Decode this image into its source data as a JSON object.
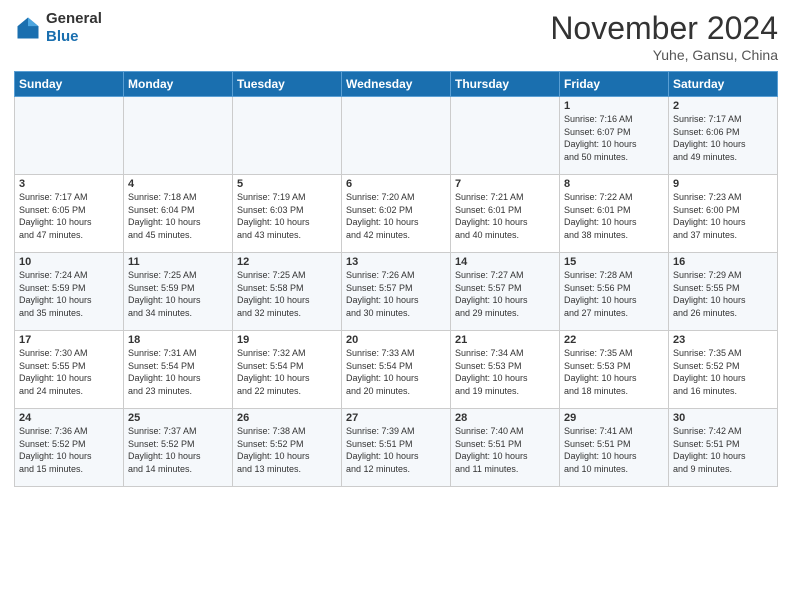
{
  "header": {
    "logo_line1": "General",
    "logo_line2": "Blue",
    "month_title": "November 2024",
    "subtitle": "Yuhe, Gansu, China"
  },
  "weekdays": [
    "Sunday",
    "Monday",
    "Tuesday",
    "Wednesday",
    "Thursday",
    "Friday",
    "Saturday"
  ],
  "weeks": [
    [
      {
        "day": "",
        "info": ""
      },
      {
        "day": "",
        "info": ""
      },
      {
        "day": "",
        "info": ""
      },
      {
        "day": "",
        "info": ""
      },
      {
        "day": "",
        "info": ""
      },
      {
        "day": "1",
        "info": "Sunrise: 7:16 AM\nSunset: 6:07 PM\nDaylight: 10 hours\nand 50 minutes."
      },
      {
        "day": "2",
        "info": "Sunrise: 7:17 AM\nSunset: 6:06 PM\nDaylight: 10 hours\nand 49 minutes."
      }
    ],
    [
      {
        "day": "3",
        "info": "Sunrise: 7:17 AM\nSunset: 6:05 PM\nDaylight: 10 hours\nand 47 minutes."
      },
      {
        "day": "4",
        "info": "Sunrise: 7:18 AM\nSunset: 6:04 PM\nDaylight: 10 hours\nand 45 minutes."
      },
      {
        "day": "5",
        "info": "Sunrise: 7:19 AM\nSunset: 6:03 PM\nDaylight: 10 hours\nand 43 minutes."
      },
      {
        "day": "6",
        "info": "Sunrise: 7:20 AM\nSunset: 6:02 PM\nDaylight: 10 hours\nand 42 minutes."
      },
      {
        "day": "7",
        "info": "Sunrise: 7:21 AM\nSunset: 6:01 PM\nDaylight: 10 hours\nand 40 minutes."
      },
      {
        "day": "8",
        "info": "Sunrise: 7:22 AM\nSunset: 6:01 PM\nDaylight: 10 hours\nand 38 minutes."
      },
      {
        "day": "9",
        "info": "Sunrise: 7:23 AM\nSunset: 6:00 PM\nDaylight: 10 hours\nand 37 minutes."
      }
    ],
    [
      {
        "day": "10",
        "info": "Sunrise: 7:24 AM\nSunset: 5:59 PM\nDaylight: 10 hours\nand 35 minutes."
      },
      {
        "day": "11",
        "info": "Sunrise: 7:25 AM\nSunset: 5:59 PM\nDaylight: 10 hours\nand 34 minutes."
      },
      {
        "day": "12",
        "info": "Sunrise: 7:25 AM\nSunset: 5:58 PM\nDaylight: 10 hours\nand 32 minutes."
      },
      {
        "day": "13",
        "info": "Sunrise: 7:26 AM\nSunset: 5:57 PM\nDaylight: 10 hours\nand 30 minutes."
      },
      {
        "day": "14",
        "info": "Sunrise: 7:27 AM\nSunset: 5:57 PM\nDaylight: 10 hours\nand 29 minutes."
      },
      {
        "day": "15",
        "info": "Sunrise: 7:28 AM\nSunset: 5:56 PM\nDaylight: 10 hours\nand 27 minutes."
      },
      {
        "day": "16",
        "info": "Sunrise: 7:29 AM\nSunset: 5:55 PM\nDaylight: 10 hours\nand 26 minutes."
      }
    ],
    [
      {
        "day": "17",
        "info": "Sunrise: 7:30 AM\nSunset: 5:55 PM\nDaylight: 10 hours\nand 24 minutes."
      },
      {
        "day": "18",
        "info": "Sunrise: 7:31 AM\nSunset: 5:54 PM\nDaylight: 10 hours\nand 23 minutes."
      },
      {
        "day": "19",
        "info": "Sunrise: 7:32 AM\nSunset: 5:54 PM\nDaylight: 10 hours\nand 22 minutes."
      },
      {
        "day": "20",
        "info": "Sunrise: 7:33 AM\nSunset: 5:54 PM\nDaylight: 10 hours\nand 20 minutes."
      },
      {
        "day": "21",
        "info": "Sunrise: 7:34 AM\nSunset: 5:53 PM\nDaylight: 10 hours\nand 19 minutes."
      },
      {
        "day": "22",
        "info": "Sunrise: 7:35 AM\nSunset: 5:53 PM\nDaylight: 10 hours\nand 18 minutes."
      },
      {
        "day": "23",
        "info": "Sunrise: 7:35 AM\nSunset: 5:52 PM\nDaylight: 10 hours\nand 16 minutes."
      }
    ],
    [
      {
        "day": "24",
        "info": "Sunrise: 7:36 AM\nSunset: 5:52 PM\nDaylight: 10 hours\nand 15 minutes."
      },
      {
        "day": "25",
        "info": "Sunrise: 7:37 AM\nSunset: 5:52 PM\nDaylight: 10 hours\nand 14 minutes."
      },
      {
        "day": "26",
        "info": "Sunrise: 7:38 AM\nSunset: 5:52 PM\nDaylight: 10 hours\nand 13 minutes."
      },
      {
        "day": "27",
        "info": "Sunrise: 7:39 AM\nSunset: 5:51 PM\nDaylight: 10 hours\nand 12 minutes."
      },
      {
        "day": "28",
        "info": "Sunrise: 7:40 AM\nSunset: 5:51 PM\nDaylight: 10 hours\nand 11 minutes."
      },
      {
        "day": "29",
        "info": "Sunrise: 7:41 AM\nSunset: 5:51 PM\nDaylight: 10 hours\nand 10 minutes."
      },
      {
        "day": "30",
        "info": "Sunrise: 7:42 AM\nSunset: 5:51 PM\nDaylight: 10 hours\nand 9 minutes."
      }
    ]
  ]
}
